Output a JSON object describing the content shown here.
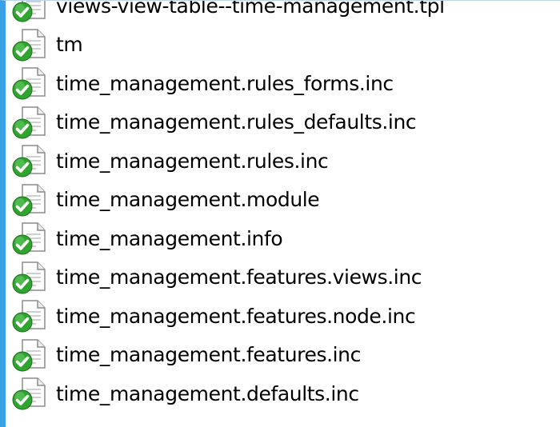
{
  "file_list": {
    "items": [
      {
        "name": "views-view-table--time-management.tpl",
        "icon": "document-icon",
        "status": "version-control-ok-icon"
      },
      {
        "name": "tm",
        "icon": "document-icon",
        "status": "version-control-ok-icon"
      },
      {
        "name": "time_management.rules_forms.inc",
        "icon": "document-icon",
        "status": "version-control-ok-icon"
      },
      {
        "name": "time_management.rules_defaults.inc",
        "icon": "document-icon",
        "status": "version-control-ok-icon"
      },
      {
        "name": "time_management.rules.inc",
        "icon": "document-icon",
        "status": "version-control-ok-icon"
      },
      {
        "name": "time_management.module",
        "icon": "document-icon",
        "status": "version-control-ok-icon"
      },
      {
        "name": "time_management.info",
        "icon": "document-icon",
        "status": "version-control-ok-icon"
      },
      {
        "name": "time_management.features.views.inc",
        "icon": "document-icon",
        "status": "version-control-ok-icon"
      },
      {
        "name": "time_management.features.node.inc",
        "icon": "document-icon",
        "status": "version-control-ok-icon"
      },
      {
        "name": "time_management.features.inc",
        "icon": "document-icon",
        "status": "version-control-ok-icon"
      },
      {
        "name": "time_management.defaults.inc",
        "icon": "document-icon",
        "status": "version-control-ok-icon"
      }
    ]
  },
  "colors": {
    "window_accent": "#3aa0e8",
    "status_ok_green": "#2fa52f",
    "row_hover": "#e5f3fb"
  }
}
